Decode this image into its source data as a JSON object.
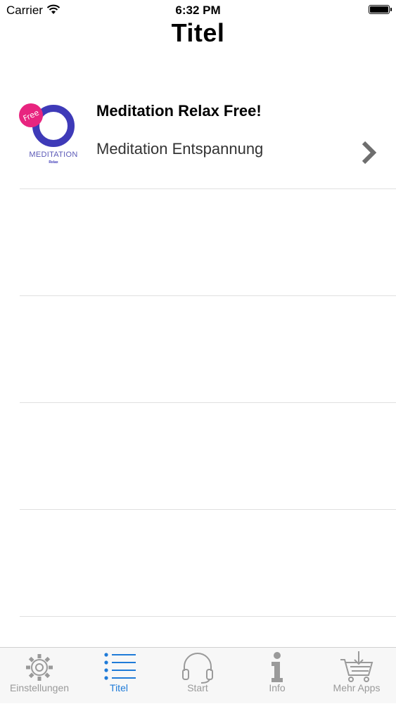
{
  "status_bar": {
    "carrier": "Carrier",
    "time": "6:32 PM"
  },
  "nav": {
    "title": "Titel"
  },
  "list": {
    "rows": [
      {
        "title": "Meditation Relax Free!",
        "subtitle": "Meditation Entspannung",
        "thumbnail": {
          "badge": "Free",
          "name": "MEDITATION",
          "tag": "Relax"
        }
      }
    ]
  },
  "tab_bar": {
    "tabs": [
      {
        "label": "Einstellungen",
        "icon": "gear-icon",
        "active": false
      },
      {
        "label": "Titel",
        "icon": "list-icon",
        "active": true
      },
      {
        "label": "Start",
        "icon": "headphones-icon",
        "active": false
      },
      {
        "label": "Info",
        "icon": "info-icon",
        "active": false
      },
      {
        "label": "Mehr Apps",
        "icon": "cart-icon",
        "active": false
      }
    ]
  },
  "colors": {
    "accent": "#1f7bd8",
    "inactive": "#9a9a9a",
    "ring": "#3e3ab8",
    "badge": "#e8247f"
  }
}
